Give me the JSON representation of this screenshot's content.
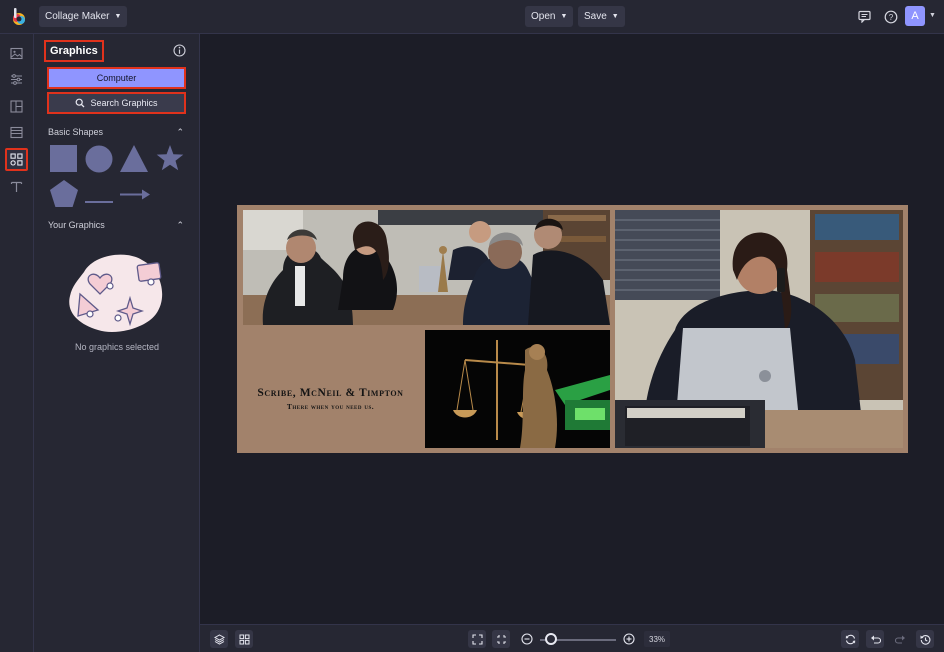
{
  "app": {
    "logo": "befunky-logo",
    "mode_label": "Collage Maker"
  },
  "topbar": {
    "open_label": "Open",
    "save_label": "Save",
    "comments_icon": "chat-icon",
    "help_icon": "help-icon",
    "avatar_initial": "A"
  },
  "rail": {
    "items": [
      {
        "icon": "image-icon",
        "active": false
      },
      {
        "icon": "sliders-icon",
        "active": false
      },
      {
        "icon": "layout-icon",
        "active": false
      },
      {
        "icon": "background-icon",
        "active": false
      },
      {
        "icon": "graphics-icon",
        "active": true
      },
      {
        "icon": "text-icon",
        "active": false
      }
    ]
  },
  "panel": {
    "title": "Graphics",
    "computer_label": "Computer",
    "search_label": "Search Graphics",
    "basic_shapes_label": "Basic Shapes",
    "shapes": [
      "square",
      "circle",
      "triangle",
      "star",
      "pentagon",
      "line",
      "arrow"
    ],
    "your_graphics_label": "Your Graphics",
    "empty_text": "No graphics selected"
  },
  "collage": {
    "caption_title": "Scribe, McNeil & Timpton",
    "caption_subtitle": "There when you need us.",
    "photos": [
      "meeting-photo",
      "justice-statue-photo",
      "phone-call-photo"
    ]
  },
  "bottombar": {
    "zoom_label": "33%",
    "zoom_level": 0.33
  },
  "colors": {
    "accent": "#8f95ff",
    "highlight_border": "#e0321c",
    "collage_background": "#a2826b"
  }
}
